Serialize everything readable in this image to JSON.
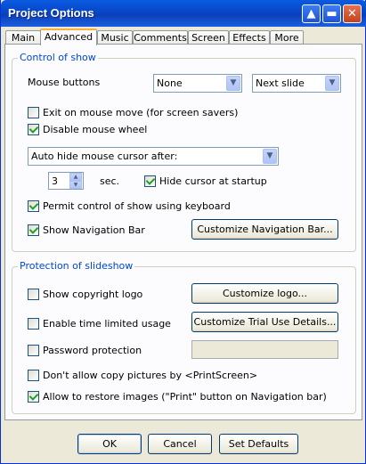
{
  "window": {
    "title": "Project Options",
    "help_glyph": "▲",
    "restore_glyph": "▬",
    "close_glyph": "✕"
  },
  "tabs": [
    {
      "label": "Main"
    },
    {
      "label": "Advanced"
    },
    {
      "label": "Music"
    },
    {
      "label": "Comments"
    },
    {
      "label": "Screen"
    },
    {
      "label": "Effects"
    },
    {
      "label": "More"
    }
  ],
  "control_of_show": {
    "group_label": "Control of show",
    "mouse_buttons_label": "Mouse buttons",
    "mouse_left_value": "None",
    "mouse_right_value": "Next slide",
    "exit_on_mouse_move": {
      "label": "Exit on mouse move (for screen savers)",
      "checked": false
    },
    "disable_mouse_wheel": {
      "label": "Disable mouse wheel",
      "checked": true
    },
    "auto_hide_value": "Auto hide mouse cursor after:",
    "seconds_value": "3",
    "seconds_unit": "sec.",
    "hide_cursor_at_startup": {
      "label": "Hide cursor at startup",
      "checked": true
    },
    "permit_keyboard": {
      "label": "Permit control of show using keyboard",
      "checked": true
    },
    "show_navigation_bar": {
      "label": "Show Navigation Bar",
      "checked": true
    },
    "customize_nav_button": "Customize Navigation Bar..."
  },
  "protection": {
    "group_label": "Protection of slideshow",
    "show_copyright_logo": {
      "label": "Show copyright logo",
      "checked": false
    },
    "customize_logo_button": "Customize logo...",
    "time_limited": {
      "label": "Enable time limited usage",
      "checked": false
    },
    "customize_trial_button": "Customize Trial Use Details...",
    "password_protection": {
      "label": "Password protection",
      "checked": false
    },
    "password_value": "",
    "no_copy_printscreen": {
      "label": "Don't allow copy pictures by <PrintScreen>",
      "checked": false
    },
    "allow_restore": {
      "label": "Allow to restore images (\"Print\" button on Navigation bar)",
      "checked": true
    }
  },
  "footer": {
    "ok": "OK",
    "cancel": "Cancel",
    "set_defaults": "Set Defaults"
  },
  "colors": {
    "titlebar": "#0846c8",
    "group_label": "#0046d5",
    "dialog_bg": "#ece9d8",
    "panel_bg": "#fcfcfe"
  }
}
